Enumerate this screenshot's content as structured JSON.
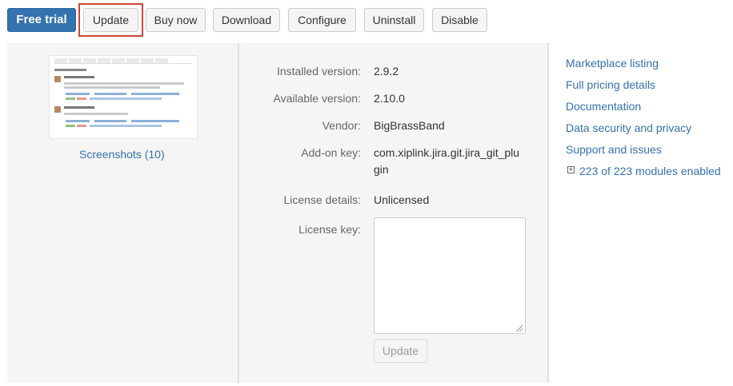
{
  "toolbar": {
    "free_trial": "Free trial",
    "update": "Update",
    "buy_now": "Buy now",
    "download": "Download",
    "configure": "Configure",
    "uninstall": "Uninstall",
    "disable": "Disable"
  },
  "screenshots": {
    "link": "Screenshots (10)"
  },
  "details": {
    "installed_version_label": "Installed version:",
    "installed_version": "2.9.2",
    "available_version_label": "Available version:",
    "available_version": "2.10.0",
    "vendor_label": "Vendor:",
    "vendor": "BigBrassBand",
    "addon_key_label": "Add-on key:",
    "addon_key_line1": "com.xiplink.jira.git.jira_git_plu",
    "addon_key_line2": "gin",
    "license_details_label": "License details:",
    "license_details": "Unlicensed",
    "license_key_label": "License key:",
    "license_key_value": "",
    "update_button": "Update"
  },
  "links": {
    "marketplace": "Marketplace listing",
    "pricing": "Full pricing details",
    "documentation": "Documentation",
    "security": "Data security and privacy",
    "support": "Support and issues",
    "modules": "223 of 223 modules enabled"
  },
  "colors": {
    "primary": "#3572b0",
    "focus": "#d04437",
    "panel": "#f5f5f5"
  }
}
